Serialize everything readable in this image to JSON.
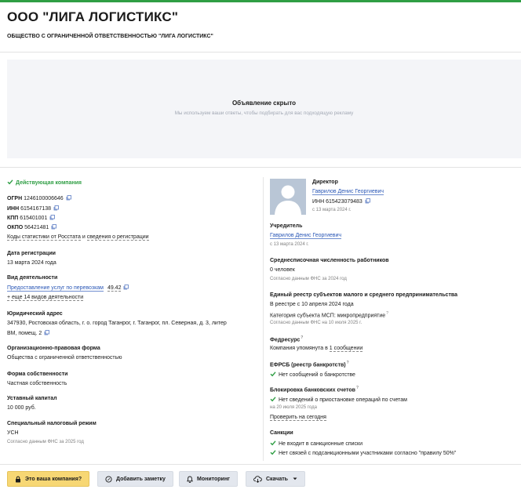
{
  "header": {
    "title": "ООО \"ЛИГА ЛОГИСТИКС\"",
    "subtitle": "ОБЩЕСТВО С ОГРАНИЧЕННОЙ ОТВЕТСТВЕННОСТЬЮ \"ЛИГА ЛОГИСТИКС\""
  },
  "ad": {
    "title": "Объявление скрыто",
    "text": "Мы используем ваши ответы, чтобы подбирать для вас подходящую рекламу"
  },
  "left": {
    "status": "Действующая компания",
    "ogrn_label": "ОГРН",
    "ogrn": "1246100006646",
    "inn_label": "ИНН",
    "inn": "6154167138",
    "kpp_label": "КПП",
    "kpp": "615401001",
    "okpo_label": "ОКПО",
    "okpo": "56421481",
    "stats_link": "Коды статистики от Росстата",
    "stats_and": "и",
    "reg_link": "сведения о регистрации",
    "reg_date_label": "Дата регистрации",
    "reg_date": "13 марта 2024 года",
    "activity_label": "Вид деятельности",
    "activity_link": "Предоставление услуг по перевозкам",
    "activity_code": "49.42",
    "activity_more": "+ еще 14 видов деятельности",
    "address_label": "Юридический адрес",
    "address_line1": "347930, Ростовская область, г. о. город Таганрог, г. Таганрог, пл. Северная, д. 3, литер",
    "address_line2": "ВМ, помещ. 2",
    "legal_form_label": "Организационно-правовая форма",
    "legal_form": "Общества с ограниченной ответственностью",
    "ownership_label": "Форма собственности",
    "ownership": "Частная собственность",
    "capital_label": "Уставный капитал",
    "capital": "10 000 руб.",
    "tax_label": "Специальный налоговый режим",
    "tax": "УСН",
    "tax_note": "Согласно данным ФНС за 2025 год"
  },
  "right": {
    "director_label": "Директор",
    "director_name": "Гаврилов Денис Георгиевич",
    "director_inn_label": "ИНН",
    "director_inn": "615423079483",
    "director_since": "с 13 марта 2024 г.",
    "founder_label": "Учредитель",
    "founder_name": "Гаврилов Денис Георгиевич",
    "founder_since": "с 13 марта 2024 г.",
    "employees_label": "Среднесписочная численность работников",
    "employees": "0 человек",
    "employees_note": "Согласно данным ФНС за 2024 год",
    "msp_label": "Единый реестр субъектов малого и среднего предпринимательства",
    "msp_since": "В реестре с 10 апреля 2024 года",
    "msp_category": "Категория субъекта МСП: микропредприятие",
    "msp_note": "Согласно данным ФНС на 10 июля 2025 г.",
    "fedresurs_label": "Федресурс",
    "fedresurs_text": "Компания упомянута в",
    "fedresurs_link": "1 сообщении",
    "efrsb_label": "ЕФРСБ (реестр банкротств)",
    "efrsb_text": "Нет сообщений о банкротстве",
    "block_label": "Блокировка банковских счетов",
    "block_text": "Нет сведений о приостановке операций по счетам",
    "block_note": "на 20 июля 2025 года",
    "block_link": "Проверить на сегодня",
    "sanctions_label": "Санкции",
    "sanctions_1": "Не входит в санкционные списки",
    "sanctions_2": "Нет связей с подсанкционными участниками согласно \"правилу 50%\"",
    "help_mark": "?"
  },
  "buttons": {
    "your_company": "Это ваша компания?",
    "add_note": "Добавить заметку",
    "monitoring": "Мониторинг",
    "download": "Скачать"
  },
  "colors": {
    "accent": "#2f9e44",
    "link": "#2a57b6",
    "yellow": "#f7d774"
  }
}
